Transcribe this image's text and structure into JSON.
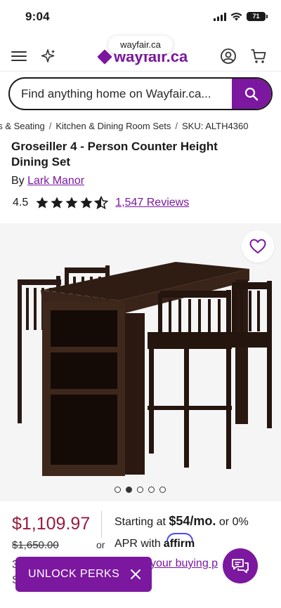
{
  "status_bar": {
    "time": "9:04",
    "battery": "71"
  },
  "browser": {
    "url": "wayfair.ca"
  },
  "header": {
    "logo_text": "wayfair.ca"
  },
  "search": {
    "placeholder": "Find anything home on Wayfair.ca..."
  },
  "breadcrumb": {
    "items": [
      "es & Seating",
      "Kitchen & Dining Room Sets"
    ],
    "sku": "SKU: ALTH4360",
    "separator": "/"
  },
  "product": {
    "title": "Groseiller 4 - Person Counter Height Dining Set",
    "by_prefix": "By",
    "brand": "Lark Manor",
    "rating": "4.5",
    "reviews": "1,547 Reviews",
    "rating_value": 4.5,
    "rating_max": 5
  },
  "gallery": {
    "image_count": 5,
    "active_index": 1
  },
  "pricing": {
    "price": "$1,109.97",
    "original_price": "$1,650.00",
    "or_label": "or",
    "starting_at": "Starting at",
    "monthly": "$54/mo.",
    "or_zero": "or 0%",
    "apr_with": "APR with",
    "affirm": "affirm",
    "buying_power": "your buying p",
    "under_fragment_1": "3",
    "under_fragment_2": "S"
  },
  "perks_banner": {
    "label": "UNLOCK PERKS"
  },
  "colors": {
    "brand": "#7b189f",
    "sale_price": "#9a1b3e",
    "affirm_arc": "#4a4af4"
  }
}
